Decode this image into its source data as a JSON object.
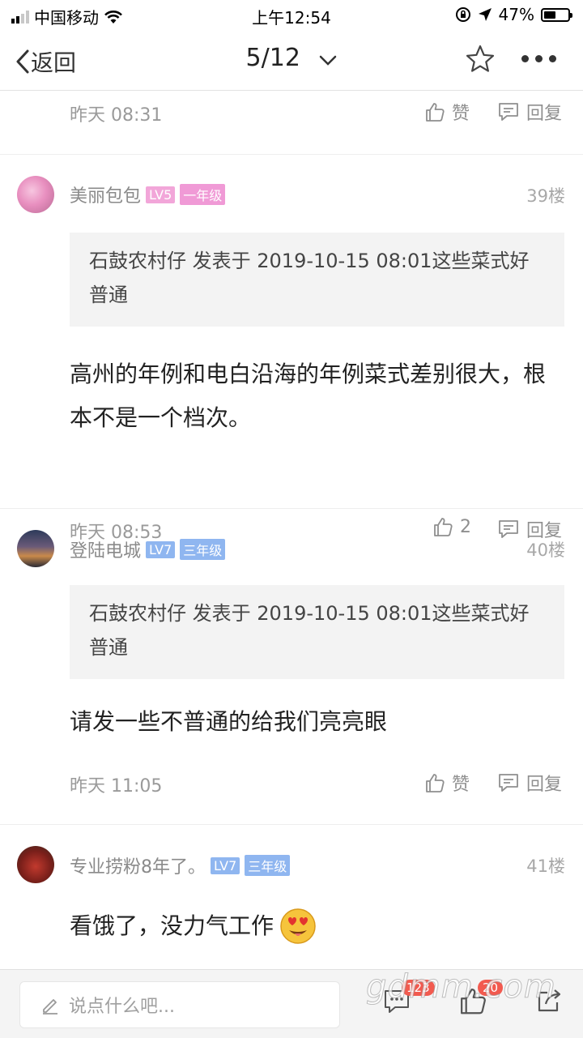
{
  "status": {
    "carrier": "中国移动",
    "time": "上午12:54",
    "battery": "47%"
  },
  "nav": {
    "back_label": "返回",
    "page": "5/12"
  },
  "top_post": {
    "time": "昨天 08:31",
    "like_label": "赞",
    "reply_label": "回复"
  },
  "posts": [
    {
      "user": "美丽包包",
      "level": "LV5",
      "grade": "一年级",
      "floor": "39楼",
      "quote": "石鼓农村仔 发表于 2019-10-15 08:01这些菜式好普通",
      "body": "高州的年例和电白沿海的年例菜式差别很大，根本不是一个档次。",
      "time": "昨天 08:53",
      "like_label": "2",
      "reply_label": "回复"
    },
    {
      "user": "登陆电城",
      "level": "LV7",
      "grade": "三年级",
      "floor": "40楼",
      "quote": "石鼓农村仔 发表于 2019-10-15 08:01这些菜式好普通",
      "body": "请发一些不普通的给我们亮亮眼",
      "time": "昨天 11:05",
      "like_label": "赞",
      "reply_label": "回复"
    },
    {
      "user": "专业捞粉8年了。",
      "level": "LV7",
      "grade": "三年级",
      "floor": "41楼",
      "body": "看饿了，没力气工作"
    }
  ],
  "bottom": {
    "input_placeholder": "说点什么吧...",
    "comment_count": "123",
    "like_count": "20",
    "watermark": "gdmm.com"
  },
  "colors": {
    "lv5_badge": "#f2a6d9",
    "lv7_badge": "#8fb6f0",
    "grade1_badge": "#f09ad6",
    "grade3_badge": "#8fb6f0"
  },
  "icons": [
    "back-icon",
    "chevron-down-icon",
    "star-icon",
    "more-icon",
    "thumb-up-icon",
    "comment-icon",
    "edit-icon",
    "share-icon"
  ]
}
